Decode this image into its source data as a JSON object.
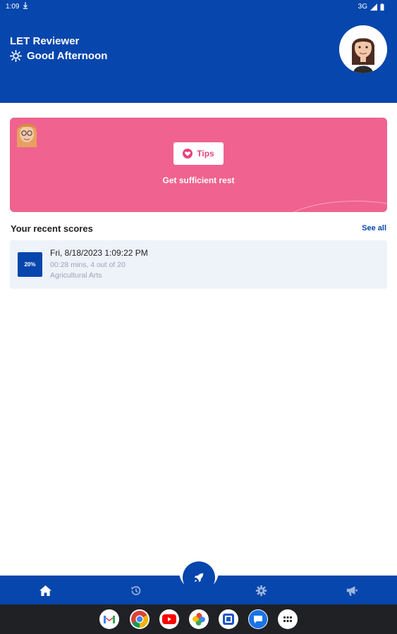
{
  "status_bar": {
    "time": "1:09",
    "network": "3G"
  },
  "header": {
    "app_title": "LET Reviewer",
    "greeting": "Good Afternoon",
    "greeting_icon": "sun-icon",
    "avatar": "profile-avatar"
  },
  "tips_card": {
    "button_label": "Tips",
    "button_icon": "heart-icon",
    "tip_text": "Get sufficient rest",
    "background_color": "#f06290"
  },
  "recent_scores": {
    "title": "Your recent scores",
    "see_all_label": "See all",
    "items": [
      {
        "score": "20%",
        "date": "Fri, 8/18/2023 1:09:22 PM",
        "details": "00:28 mins, 4 out of 20",
        "subject": "Agricultural Arts"
      }
    ]
  },
  "bottom_nav": {
    "items": [
      "home-icon",
      "history-icon",
      "rocket-icon",
      "settings-icon",
      "announcement-icon"
    ],
    "accent_color": "#0646ad"
  },
  "dock": {
    "apps": [
      "gmail-icon",
      "chrome-icon",
      "youtube-icon",
      "photos-icon",
      "app-icon",
      "messages-icon",
      "app-drawer-icon"
    ]
  }
}
